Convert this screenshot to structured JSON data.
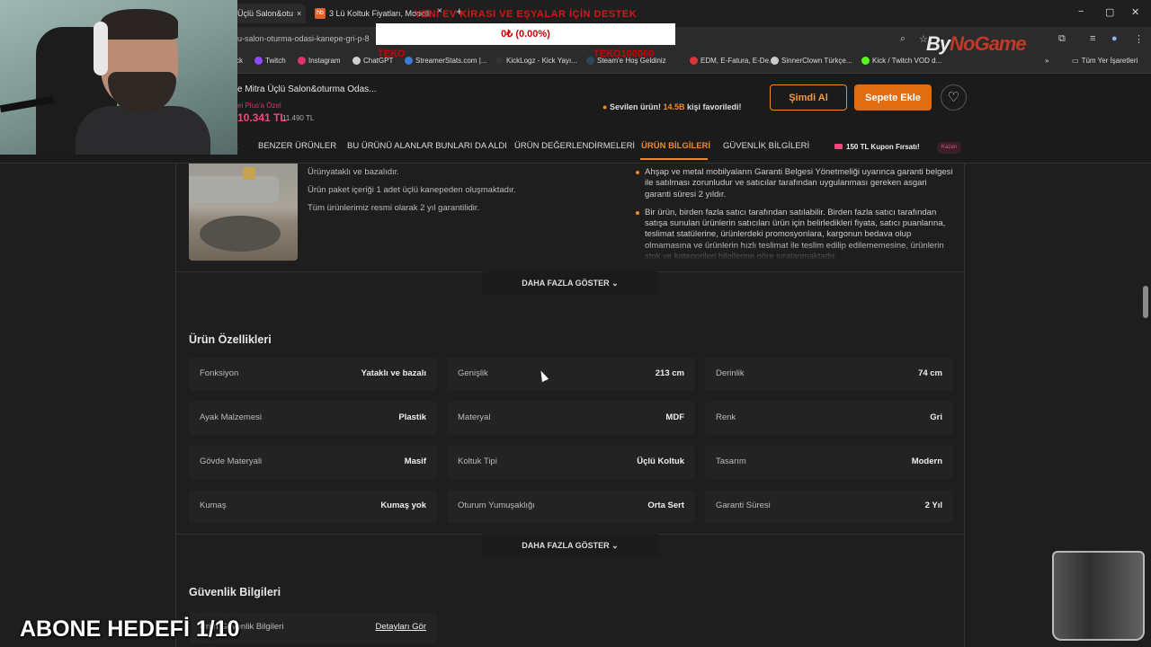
{
  "browser": {
    "tabs": [
      {
        "label": "Üçlü Salon&otu"
      },
      {
        "label": "3 Lü Koltuk Fiyatları, Modelleri"
      }
    ],
    "close": "×",
    "new_tab": "+",
    "url": "u-salon-oturma-odasi-kanepe-gri-p-8",
    "window": {
      "minimize": "−",
      "maximize": "▢",
      "close": "✕"
    },
    "bookmarks": [
      {
        "label": "ck",
        "icon": "",
        "color": "#888"
      },
      {
        "label": "Twitch",
        "icon": "twitch-icon",
        "color": "#9146ff"
      },
      {
        "label": "Instagram",
        "icon": "instagram-icon",
        "color": "#e1306c"
      },
      {
        "label": "ChatGPT",
        "icon": "chatgpt-icon",
        "color": "#cfcfcf"
      },
      {
        "label": "StreamerStats.com |...",
        "icon": "streamerstats-icon",
        "color": "#3a7bd5"
      },
      {
        "label": "KickLogz - Kick Yayı...",
        "icon": "kicklogz-icon",
        "color": "#333"
      },
      {
        "label": "Steam'e Hoş Geldiniz",
        "icon": "steam-icon",
        "color": "#2a475e"
      },
      {
        "label": "EDM, E-Fatura, E-De...",
        "icon": "edm-icon",
        "color": "#d33"
      },
      {
        "label": "SinnerClown Türkçe...",
        "icon": "globe-icon",
        "color": "#ccc"
      },
      {
        "label": "Kick / Twitch VOD d...",
        "icon": "kick-icon",
        "color": "#53fc18"
      }
    ],
    "bookmarks_more": "»",
    "all_bookmarks": "Tüm Yer İşaretleri"
  },
  "overlay": {
    "donate_title": "YENİ EV KİRASI VE EŞYALAR İÇİN DESTEK",
    "donate_progress": "0₺ (0.00%)",
    "donate_start": "TEKO",
    "donate_goal": "TEKO100000",
    "progress_fraction": 0.0,
    "brand_a": "By",
    "brand_b": "NoGame",
    "sub_goal": "ABONE HEDEFİ 1/10"
  },
  "product": {
    "title": "e Mitra Üçlü Salon&oturma Odas...",
    "plus_note": "ei Plus'a Özel",
    "price": "10.341 TL",
    "old_price": "11.490 TL",
    "fav_prefix": "Sevilen ürün! ",
    "fav_count": "14.5B",
    "fav_suffix": " kişi favoriledi!",
    "buy_now": "Şimdi Al",
    "add_to_cart": "Sepete Ekle",
    "fav_icon": "♡"
  },
  "nav": {
    "tabs": [
      "R",
      "BENZER ÜRÜNLER",
      "BU ÜRÜNÜ ALANLAR BUNLARI DA ALDI",
      "ÜRÜN DEĞERLENDİRMELERİ",
      "ÜRÜN BİLGİLERİ",
      "GÜVENLİK BİLGİLERİ"
    ],
    "active": 4,
    "coupon": "150 TL Kupon Fırsatı!",
    "coupon_btn": "Kazan"
  },
  "info": {
    "lines": [
      "Ürünyataklı ve bazalıdır.",
      "Ürün paket içeriği 1 adet üçlü kanepeden oluşmaktadır.",
      "Tüm ürünlerimiz resmi olarak 2 yıl garantilidir."
    ],
    "bullets": [
      "Ahşap ve metal mobilyaların Garanti Belgesi Yönetmeliği uyarınca garanti belgesi ile satılması zorunludur ve satıcılar tarafından uygulanması gereken asgari garanti süresi 2 yıldır.",
      "Bir ürün, birden fazla satıcı tarafından satılabilir. Birden fazla satıcı tarafından satışa sunulan ürünlerin satıcıları ürün için belirledikleri fiyata, satıcı puanlarına, teslimat statülerine, ürünlerdeki promosyonlara, kargonun bedava olup olmamasına ve ürünlerin hızlı teslimat ile teslim edilip edilememesine, ürünlerin stok ve kategorileri bilgilerine göre sıralanmaktadır."
    ],
    "more": "DAHA FAZLA GÖSTER"
  },
  "features": {
    "title": "Ürün Özellikleri",
    "items": [
      {
        "k": "Fonksiyon",
        "v": "Yataklı ve bazalı"
      },
      {
        "k": "Genişlik",
        "v": "213 cm"
      },
      {
        "k": "Derinlik",
        "v": "74 cm"
      },
      {
        "k": "Ayak Malzemesi",
        "v": "Plastik"
      },
      {
        "k": "Materyal",
        "v": "MDF"
      },
      {
        "k": "Renk",
        "v": "Gri"
      },
      {
        "k": "Gövde Materyali",
        "v": "Masif"
      },
      {
        "k": "Koltuk Tipi",
        "v": "Üçlü Koltuk"
      },
      {
        "k": "Tasarım",
        "v": "Modern"
      },
      {
        "k": "Kumaş",
        "v": "Kumaş yok"
      },
      {
        "k": "Oturum Yumuşaklığı",
        "v": "Orta Sert"
      },
      {
        "k": "Garanti Süresi",
        "v": "2 Yıl"
      }
    ],
    "more": "DAHA FAZLA GÖSTER"
  },
  "security": {
    "title": "Güvenlik Bilgileri",
    "row_label": "Ürün Güvenlik Bilgileri",
    "row_link": "Detayları Gör"
  }
}
